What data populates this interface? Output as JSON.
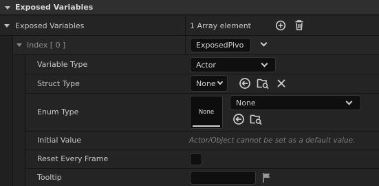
{
  "section": {
    "title": "Exposed Variables"
  },
  "array_row": {
    "label": "Exposed Variables",
    "value": "1 Array element"
  },
  "index_row": {
    "label": "Index [ 0 ]",
    "value": "ExposedPivo"
  },
  "properties": {
    "variable_type": {
      "label": "Variable Type",
      "value": "Actor"
    },
    "struct_type": {
      "label": "Struct Type",
      "value": "None"
    },
    "enum_type": {
      "label": "Enum Type",
      "thumb_label": "None",
      "value": "None"
    },
    "initial_value": {
      "label": "Initial Value",
      "hint": "Actor/Object cannot be set as a default value."
    },
    "reset_every_frame": {
      "label": "Reset Every Frame"
    },
    "tooltip": {
      "label": "Tooltip"
    }
  },
  "icons": {
    "add": "plus-circle-icon",
    "delete": "trash-icon",
    "use_selected": "arrow-left-circle-icon",
    "browse": "folder-search-icon",
    "clear": "close-icon",
    "flag": "flag-icon"
  }
}
